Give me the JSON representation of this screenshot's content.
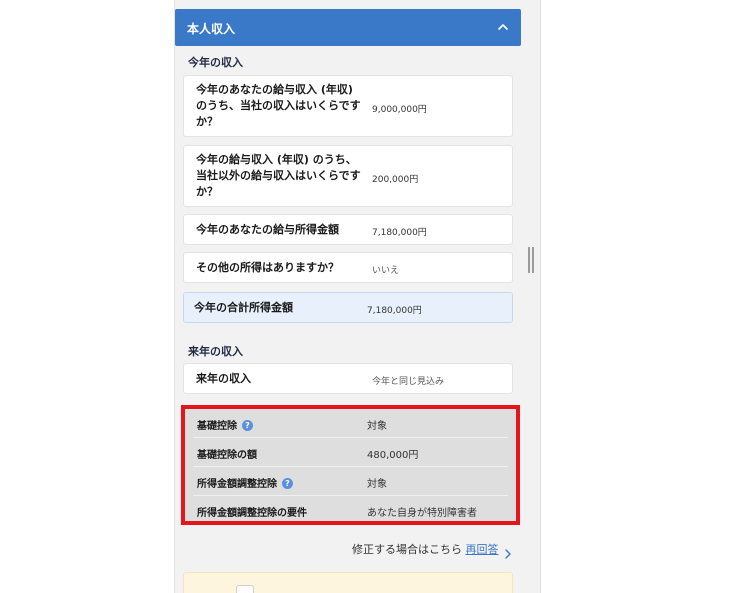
{
  "header": {
    "title": "本人収入"
  },
  "this_year": {
    "section_title": "今年の収入",
    "rows": [
      {
        "question": "今年のあなたの給与収入 (年収) のうち、当社の収入はいくらですか？",
        "value": "9,000,000円"
      },
      {
        "question": "今年の給与収入 (年収) のうち、当社以外の給与収入はいくらですか？",
        "value": "200,000円"
      },
      {
        "question": "今年のあなたの給与所得金額",
        "value": "7,180,000円"
      },
      {
        "question": "その他の所得はありますか？",
        "value": "いいえ"
      }
    ],
    "total": {
      "label": "今年の合計所得金額",
      "value": "7,180,000円"
    }
  },
  "next_year": {
    "section_title": "来年の収入",
    "row": {
      "label": "来年の収入",
      "value": "今年と同じ見込み"
    }
  },
  "deductions": [
    {
      "label": "基礎控除",
      "value": "対象",
      "help": true
    },
    {
      "label": "基礎控除の額",
      "value": "480,000円",
      "help": false
    },
    {
      "label": "所得金額調整控除",
      "value": "対象",
      "help": true
    },
    {
      "label": "所得金額調整控除の要件",
      "value": "あなた自身が特別障害者",
      "help": false
    }
  ],
  "help_symbol": "?",
  "footer": {
    "text": "修正する場合はこちら",
    "link": "再回答"
  },
  "colors": {
    "header": "#3a78c8",
    "highlight_border": "#e4161c",
    "total_bg": "#e8f0fb"
  }
}
